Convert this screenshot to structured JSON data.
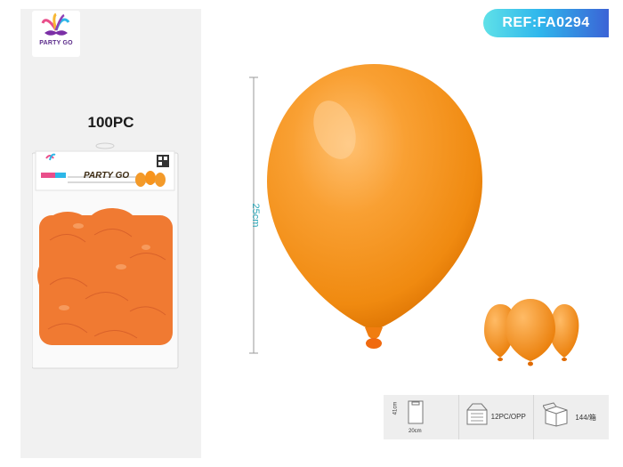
{
  "brand": {
    "logo_text": "PARTY GO"
  },
  "quantity_label": "100PC",
  "reference": "REF:FA0294",
  "dimensions": {
    "height_label": "25cm"
  },
  "package": {
    "brand_text": "PARTY GO"
  },
  "specs": {
    "bag_height": "41cm",
    "bag_width": "20cm",
    "inner_pack": "12PC/OPP",
    "carton": "144/箱"
  },
  "colors": {
    "balloon": "#f7941d",
    "badge_start": "#5fe1e8",
    "badge_end": "#3b63d6",
    "measure": "#2aa7b8"
  }
}
